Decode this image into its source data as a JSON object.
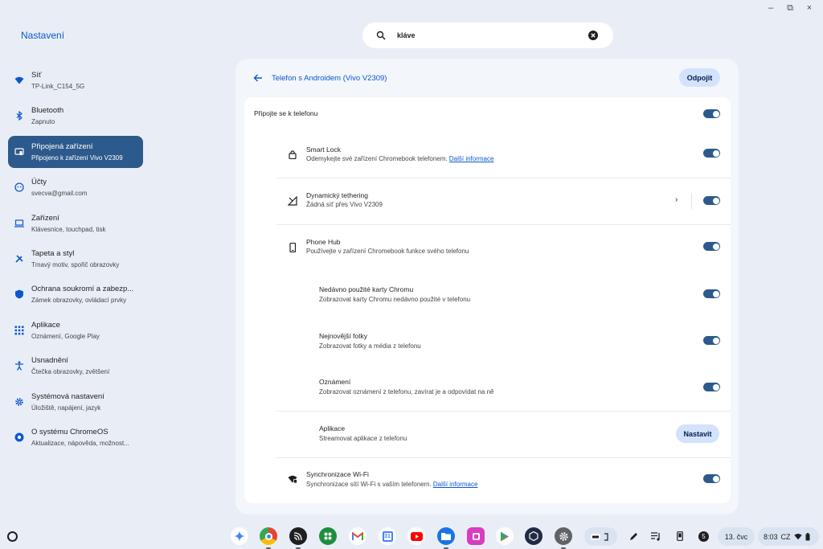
{
  "window": {
    "minimize": "–",
    "restore": "⧉",
    "close": "×"
  },
  "app": {
    "title": "Nastavení"
  },
  "search": {
    "value": "kláve"
  },
  "sidebar": {
    "items": [
      {
        "label": "Síť",
        "sub": "TP-Link_C154_5G",
        "icon": "wifi-icon"
      },
      {
        "label": "Bluetooth",
        "sub": "Zapnuto",
        "icon": "bluetooth-icon"
      },
      {
        "label": "Připojená zařízení",
        "sub": "Připojeno k zařízení Vivo V2309",
        "icon": "connected-devices-icon",
        "active": true
      },
      {
        "label": "Účty",
        "sub": "svecva@gmail.com",
        "icon": "account-icon"
      },
      {
        "label": "Zařízení",
        "sub": "Klávesnice, touchpad, tisk",
        "icon": "laptop-icon"
      },
      {
        "label": "Tapeta a styl",
        "sub": "Tmavý motiv, spořič obrazovky",
        "icon": "palette-icon"
      },
      {
        "label": "Ochrana soukromí a zabezp...",
        "sub": "Zámek obrazovky, ovládací prvky",
        "icon": "shield-icon"
      },
      {
        "label": "Aplikace",
        "sub": "Oznámení, Google Play",
        "icon": "apps-grid-icon"
      },
      {
        "label": "Usnadnění",
        "sub": "Čtečka obrazovky, zvětšení",
        "icon": "accessibility-icon"
      },
      {
        "label": "Systémová nastavení",
        "sub": "Úložiště, napájení, jazyk",
        "icon": "gear-icon"
      },
      {
        "label": "O systému ChromeOS",
        "sub": "Aktualizace, nápověda, možnost...",
        "icon": "chromeos-icon"
      }
    ]
  },
  "panel": {
    "title": "Telefon s Androidem (Vivo V2309)",
    "disconnect_label": "Odpojit",
    "connect_label": "Připojte se k telefonu",
    "smart_lock": {
      "title": "Smart Lock",
      "sub": "Odemykejte své zařízení Chromebook telefonem.",
      "link": "Další informace"
    },
    "tethering": {
      "title": "Dynamický tethering",
      "sub": "Žádná síť přes Vivo V2309",
      "chevron": "›"
    },
    "phone_hub": {
      "title": "Phone Hub",
      "sub": "Používejte v zařízení Chromebook funkce svého telefonu"
    },
    "recent_tabs": {
      "title": "Nedávno použité karty Chromu",
      "sub": "Zobrazovat karty Chromu nedávno použité v telefonu"
    },
    "photos": {
      "title": "Nejnovější fotky",
      "sub": "Zobrazovat fotky a média z telefonu"
    },
    "notifications": {
      "title": "Oznámení",
      "sub": "Zobrazovat oznámení z telefonu, zavírat je a odpovídat na ně"
    },
    "apps": {
      "title": "Aplikace",
      "sub": "Streamovat aplikace z telefonu",
      "button": "Nastavit"
    },
    "wifi_sync": {
      "title": "Synchronizace Wi-Fi",
      "sub": "Synchronizace sítí Wi-Fi s vaším telefonem.",
      "link": "Další informace"
    },
    "toggles_on": true
  },
  "shelf": {
    "apps": [
      "gemini-icon",
      "chrome-icon",
      "cast-icon",
      "play-games-icon",
      "gmail-icon",
      "calendar-icon",
      "youtube-icon",
      "files-icon",
      "gallery-icon",
      "play-store-icon",
      "app-icon",
      "settings-icon"
    ],
    "notification_count": "5",
    "date": "13. čvc",
    "time": "8:03",
    "locale": "CZ"
  },
  "colors": {
    "accent": "#2c5a8c",
    "link": "#0b57d0",
    "pill": "#d3e3fd"
  }
}
